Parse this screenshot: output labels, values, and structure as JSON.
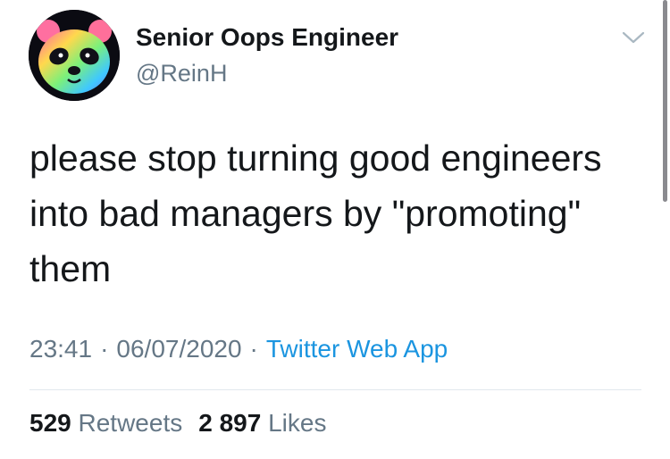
{
  "author": {
    "display_name": "Senior Oops Engineer",
    "handle": "@ReinH",
    "avatar_icon": "rainbow-panda-avatar"
  },
  "tweet": {
    "text": "please stop turning good engineers into bad managers by \"promoting\" them",
    "time": "23:41",
    "date": "06/07/2020",
    "separator": "·",
    "source": "Twitter Web App"
  },
  "stats": {
    "retweets_count": "529",
    "retweets_label": "Retweets",
    "likes_count": "2 897",
    "likes_label": "Likes"
  },
  "colors": {
    "primary_text": "#14171a",
    "secondary_text": "#657786",
    "link": "#1b95e0",
    "divider": "#e1e8ed"
  },
  "icons": {
    "menu": "chevron-down-icon"
  }
}
